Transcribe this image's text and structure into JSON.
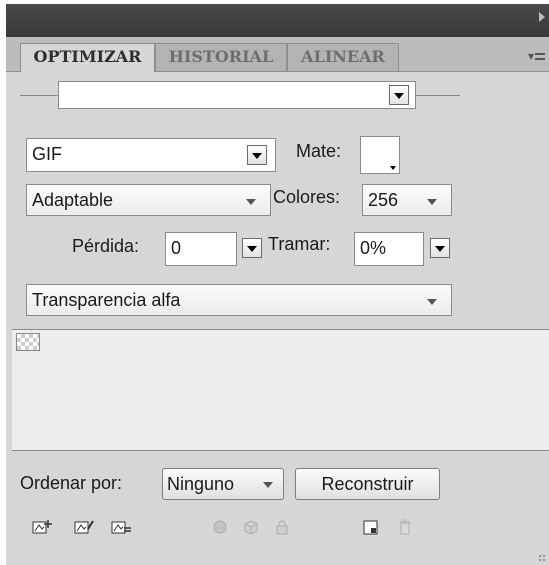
{
  "tabs": [
    {
      "label": "OPTIMIZAR",
      "active": true
    },
    {
      "label": "HISTORIAL",
      "active": false
    },
    {
      "label": "ALINEAR",
      "active": false
    }
  ],
  "preset": {
    "value": ""
  },
  "format": {
    "value": "GIF"
  },
  "matte": {
    "label": "Mate:"
  },
  "palette": {
    "value": "Adaptable"
  },
  "colors": {
    "label": "Colores:",
    "value": "256"
  },
  "loss": {
    "label": "Pérdida:",
    "value": "0"
  },
  "dither": {
    "label": "Tramar:",
    "value": "0%"
  },
  "transparency": {
    "value": "Transparencia alfa"
  },
  "sort": {
    "label": "Ordenar por:",
    "value": "Ninguno"
  },
  "rebuild": {
    "label": "Reconstruir"
  },
  "toolbar_icons": [
    "add-to-palette-icon",
    "edit-color-icon",
    "remove-color-icon",
    "web-snap-icon",
    "cube-icon",
    "lock-color-icon",
    "new-color-icon",
    "trash-icon"
  ],
  "colors_theme": {
    "panel_bg": "#d6d6d6",
    "titlebar": "#3f3f3f",
    "tab_active": "#d6d6d6",
    "tab_inactive": "#b3b3b3"
  }
}
